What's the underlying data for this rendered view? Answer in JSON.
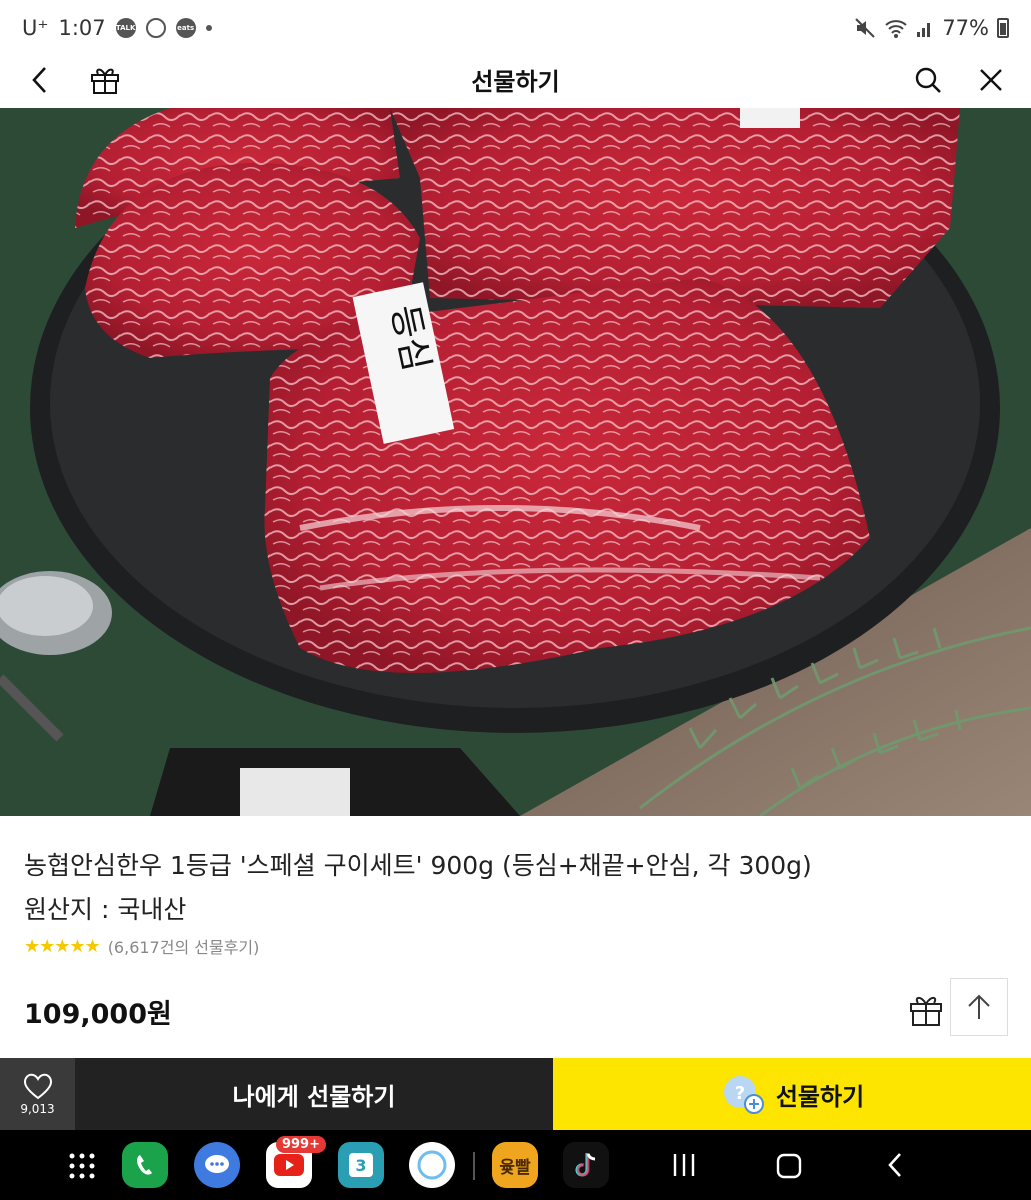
{
  "status": {
    "carrier": "U⁺",
    "time": "1:07",
    "talk_badge": "TALK",
    "eats_badge": "eats",
    "battery": "77%"
  },
  "header": {
    "title": "선물하기",
    "back_icon": "chevron-left-icon",
    "gift_icon": "gift-icon",
    "search_icon": "search-icon",
    "close_icon": "close-icon"
  },
  "hero": {
    "tag_text": "등심"
  },
  "product": {
    "title": "농협안심한우 1등급 '스페셜 구이세트' 900g (등심+채끝+안심, 각 300g)",
    "origin": "원산지 : 국내산",
    "stars": "★★★★★",
    "review_text": "(6,617건의 선물후기)",
    "price": "109,000원"
  },
  "actions": {
    "wish_count": "9,013",
    "self_gift_label": "나에게 선물하기",
    "gift_label": "선물하기"
  },
  "nav": {
    "youtube_badge": "999+",
    "calendar_day": "3",
    "game_label": "윷빨"
  },
  "colors": {
    "accent_yellow": "#fee500",
    "dark_button": "#222222",
    "star": "#f5c800"
  }
}
